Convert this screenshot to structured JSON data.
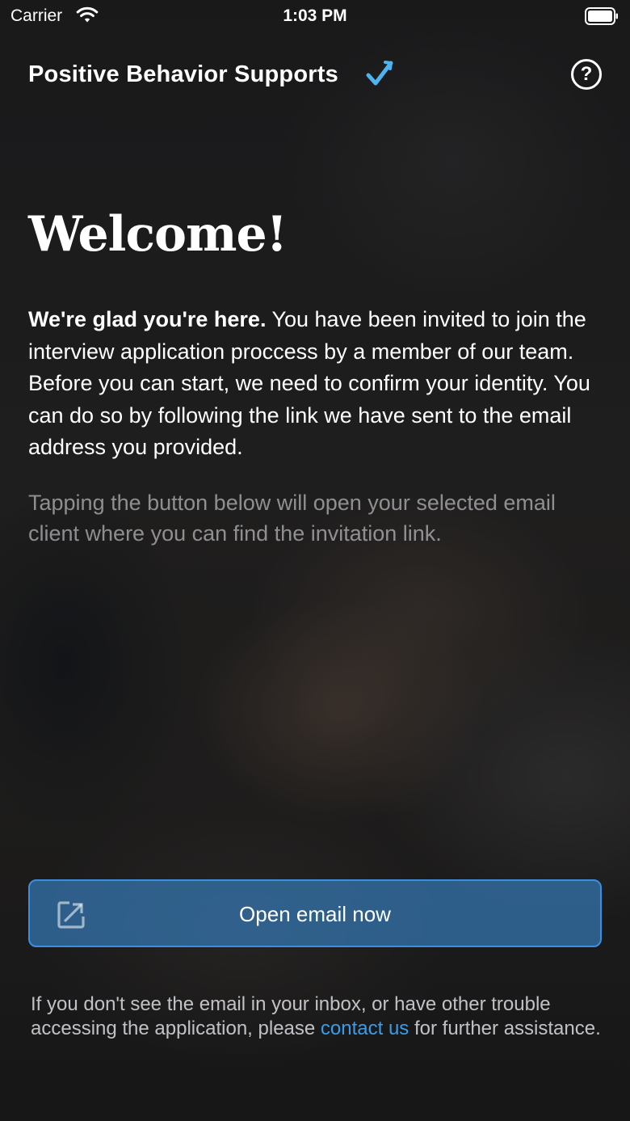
{
  "status_bar": {
    "carrier": "Carrier",
    "time": "1:03 PM",
    "icons": [
      "wifi-icon",
      "battery-icon"
    ]
  },
  "header": {
    "title": "Positive Behavior Supports",
    "title_icon": "checkmark-icon",
    "help_icon": "question-circle-icon",
    "help_glyph": "?"
  },
  "main": {
    "welcome": "Welcome!",
    "intro_bold": "We're glad you're here.",
    "intro_text": " You have been invited to join the interview application proccess by a member of our team. Before you can start, we need to confirm your identity. You can do so by following the link we have sent to the email address you provided.",
    "hint": "Tapping the button below will open your selected email client where you can find the invitation link."
  },
  "action": {
    "open_email_label": "Open email now",
    "icon": "external-link-icon"
  },
  "footer": {
    "text_before": "If you don't see the email in your inbox, or have other trouble accessing the application, please ",
    "link": "contact us",
    "text_after": " for further assistance."
  },
  "colors": {
    "accent": "#3a9ce8",
    "button_fill": "#3478b4",
    "button_border": "#3a8fe0",
    "check": "#4fb3f0"
  }
}
